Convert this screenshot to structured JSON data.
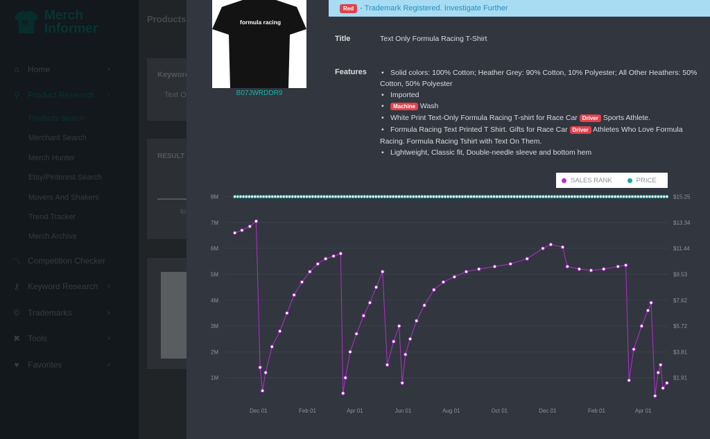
{
  "app": {
    "logo_line1": "Merch",
    "logo_line2": "Informer",
    "page_title": "Products Search"
  },
  "sidebar": {
    "items": [
      {
        "label": "Home",
        "icon": "home-icon",
        "chevron": "›"
      },
      {
        "label": "Product Research",
        "icon": "search-icon",
        "chevron": "›"
      },
      {
        "label": "Competition Checker",
        "icon": "trend-icon"
      },
      {
        "label": "Keyword Research",
        "icon": "key-icon",
        "chevron": "›"
      },
      {
        "label": "Trademarks",
        "icon": "copyright-icon",
        "chevron": "›"
      },
      {
        "label": "Tools",
        "icon": "tools-icon",
        "chevron": "›"
      },
      {
        "label": "Favorites",
        "icon": "heart-icon",
        "chevron": "›"
      }
    ],
    "sub_items": [
      {
        "label": "Products Search"
      },
      {
        "label": "Merchant Search"
      },
      {
        "label": "Merch Hunter"
      },
      {
        "label": "Etsy/Pinterest Search"
      },
      {
        "label": "Movers And Shakers"
      },
      {
        "label": "Trend Tracker"
      },
      {
        "label": "Merch Archive"
      }
    ]
  },
  "background": {
    "keyword_label": "Keyword",
    "keyword_value": "Text On",
    "results_label": "RESULT",
    "results_fragment": "to"
  },
  "modal": {
    "image_text": "formula racing",
    "asin": "B07JWRDDR9",
    "alert_badge": "Red",
    "alert_text": " - Trademark Registered. Investigate Further",
    "title_label": "Title",
    "title_value": "Text Only Formula Racing T-Shirt",
    "features_label": "Features",
    "features": {
      "f1": "Solid colors: 100% Cotton; Heather Grey: 90% Cotton, 10% Polyester; All Other Heathers: 50% Cotton, 50% Polyester",
      "f2": "Imported",
      "f3_badge": "Machine",
      "f3_text": " Wash",
      "f4_pre": "White Print Text-Only Formula Racing T-shirt for Race Car ",
      "f4_badge": "Driver",
      "f4_post": " Sports Athlete.",
      "f5_pre": "Formula Racing Text Printed T Shirt. Gifts for Race Car ",
      "f5_badge": "Driver",
      "f5_post": " Athletes Who Love Formula Racing. Formula Racing Tshirt with Text On Them.",
      "f6": "Lightweight, Classic fit, Double-needle sleeve and bottom hem"
    }
  },
  "colors": {
    "sales_rank": "#b42fd0",
    "price": "#1aa7a2",
    "accent": "#18b3a8",
    "badge_red": "#e0424d"
  },
  "chart_data": {
    "type": "line",
    "legend": [
      "SALES RANK",
      "PRICE"
    ],
    "legend_placement": "top-right",
    "x_ticks": [
      "Dec 01",
      "Feb 01",
      "Apr 01",
      "Jun 01",
      "Aug 01",
      "Oct 01",
      "Dec 01",
      "Feb 01",
      "Apr 01"
    ],
    "y_left_ticks": [
      "8M",
      "7M",
      "6M",
      "5M",
      "4M",
      "3M",
      "2M",
      "1M"
    ],
    "y_right_ticks": [
      "$15.25",
      "$13.34",
      "$11.44",
      "$9.53",
      "$7.62",
      "$5.72",
      "$3.81",
      "$1.91"
    ],
    "y_left_range": [
      0,
      8000000
    ],
    "y_right_range": [
      0,
      15.25
    ],
    "series": [
      {
        "name": "SALES RANK",
        "points": [
          [
            "2019-11-01",
            6600000
          ],
          [
            "2019-11-10",
            6700000
          ],
          [
            "2019-11-20",
            6850000
          ],
          [
            "2019-11-28",
            7050000
          ],
          [
            "2019-12-03",
            1400000
          ],
          [
            "2019-12-06",
            500000
          ],
          [
            "2019-12-10",
            1200000
          ],
          [
            "2019-12-18",
            2200000
          ],
          [
            "2019-12-28",
            2800000
          ],
          [
            "2020-01-06",
            3500000
          ],
          [
            "2020-01-15",
            4200000
          ],
          [
            "2020-01-25",
            4700000
          ],
          [
            "2020-02-04",
            5100000
          ],
          [
            "2020-02-14",
            5400000
          ],
          [
            "2020-02-24",
            5600000
          ],
          [
            "2020-03-05",
            5700000
          ],
          [
            "2020-03-14",
            5800000
          ],
          [
            "2020-03-17",
            400000
          ],
          [
            "2020-03-20",
            1000000
          ],
          [
            "2020-03-26",
            2000000
          ],
          [
            "2020-04-03",
            2700000
          ],
          [
            "2020-04-12",
            3400000
          ],
          [
            "2020-04-20",
            3900000
          ],
          [
            "2020-04-28",
            4500000
          ],
          [
            "2020-05-06",
            5100000
          ],
          [
            "2020-05-12",
            1500000
          ],
          [
            "2020-05-20",
            2400000
          ],
          [
            "2020-05-27",
            3000000
          ],
          [
            "2020-05-31",
            800000
          ],
          [
            "2020-06-04",
            1900000
          ],
          [
            "2020-06-10",
            2500000
          ],
          [
            "2020-06-18",
            3200000
          ],
          [
            "2020-06-28",
            3800000
          ],
          [
            "2020-07-10",
            4400000
          ],
          [
            "2020-07-22",
            4700000
          ],
          [
            "2020-08-05",
            4900000
          ],
          [
            "2020-08-20",
            5100000
          ],
          [
            "2020-09-05",
            5200000
          ],
          [
            "2020-09-25",
            5300000
          ],
          [
            "2020-10-15",
            5400000
          ],
          [
            "2020-11-05",
            5600000
          ],
          [
            "2020-11-25",
            6000000
          ],
          [
            "2020-12-05",
            6150000
          ],
          [
            "2020-12-20",
            6050000
          ],
          [
            "2020-12-26",
            5300000
          ],
          [
            "2021-01-10",
            5200000
          ],
          [
            "2021-01-25",
            5150000
          ],
          [
            "2021-02-10",
            5200000
          ],
          [
            "2021-02-28",
            5300000
          ],
          [
            "2021-03-10",
            5350000
          ],
          [
            "2021-03-14",
            900000
          ],
          [
            "2021-03-20",
            2100000
          ],
          [
            "2021-03-30",
            3000000
          ],
          [
            "2021-04-07",
            3600000
          ],
          [
            "2021-04-11",
            3900000
          ],
          [
            "2021-04-16",
            300000
          ],
          [
            "2021-04-20",
            1200000
          ],
          [
            "2021-04-23",
            1500000
          ],
          [
            "2021-04-26",
            600000
          ],
          [
            "2021-05-01",
            800000
          ]
        ]
      },
      {
        "name": "PRICE",
        "points": [
          [
            "2019-11-01",
            15.25
          ],
          [
            "2021-05-01",
            15.25
          ]
        ]
      }
    ]
  }
}
